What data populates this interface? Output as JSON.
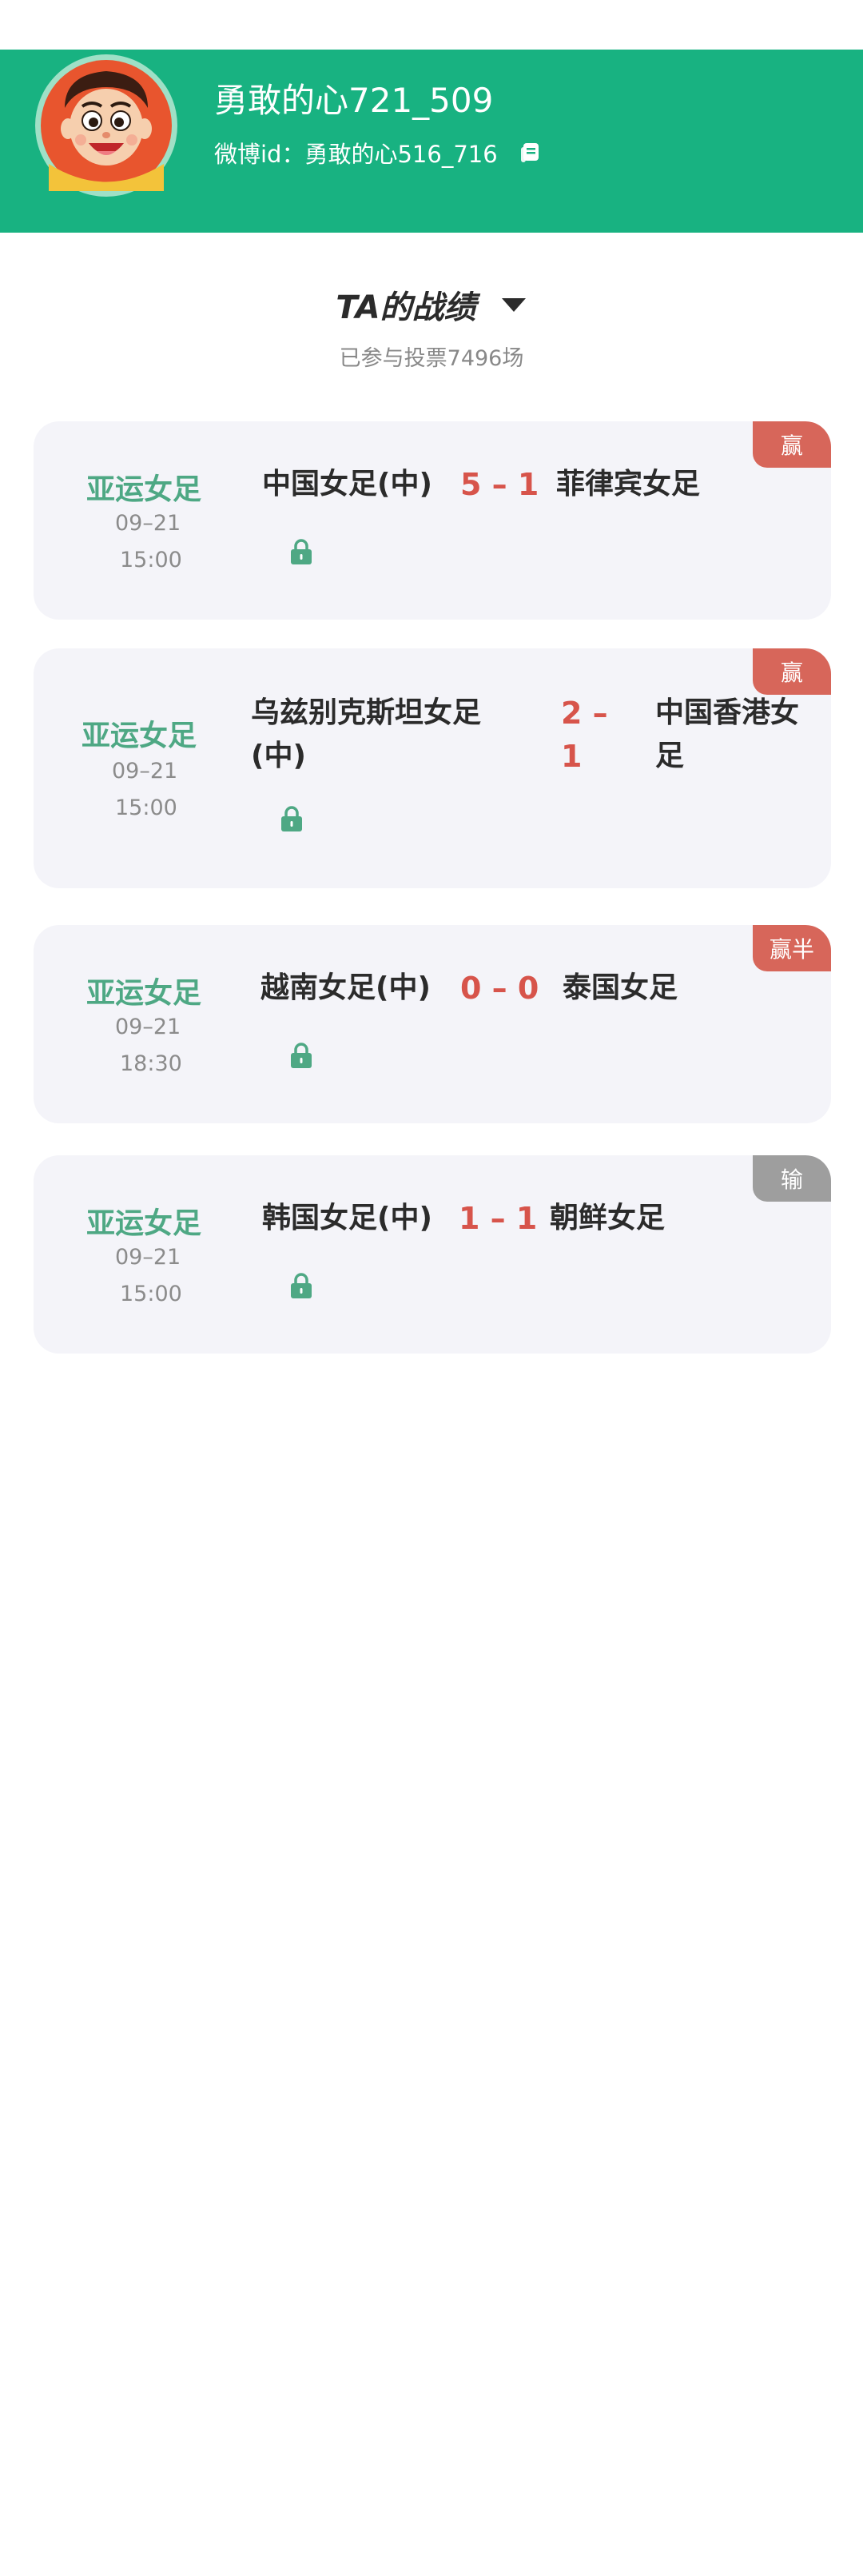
{
  "profile": {
    "name": "勇敢的心721_509",
    "weibo_id": "微博id：勇敢的心516_716"
  },
  "icons": {
    "copy": "copy-icon",
    "dropdown": "caret-down-icon",
    "lock": "lock-icon",
    "avatar": "cartoon-boy-avatar"
  },
  "record": {
    "title": "TA的战绩",
    "vote_count": "已参与投票7496场"
  },
  "colors": {
    "brand_green": "#18b281",
    "league_green": "#4ea884",
    "score_red": "#d7544b",
    "win_badge": "#d7665a",
    "lose_badge": "#9e9e9e"
  },
  "matches": [
    {
      "league": "亚运女足",
      "date": "09–21",
      "time": "15:00",
      "home": "中国女足(中)",
      "score": "5 – 1",
      "away": "菲律宾女足",
      "result": "赢"
    },
    {
      "league": "亚运女足",
      "date": "09–21",
      "time": "15:00",
      "home": "乌兹别克斯坦女足(中)",
      "score": "2 – 1",
      "away": "中国香港女足",
      "result": "赢"
    },
    {
      "league": "亚运女足",
      "date": "09–21",
      "time": "18:30",
      "home": "越南女足(中)",
      "score": "0 – 0",
      "away": "泰国女足",
      "result": "赢半"
    },
    {
      "league": "亚运女足",
      "date": "09–21",
      "time": "15:00",
      "home": "韩国女足(中)",
      "score": "1 – 1",
      "away": "朝鲜女足",
      "result": "输"
    }
  ]
}
